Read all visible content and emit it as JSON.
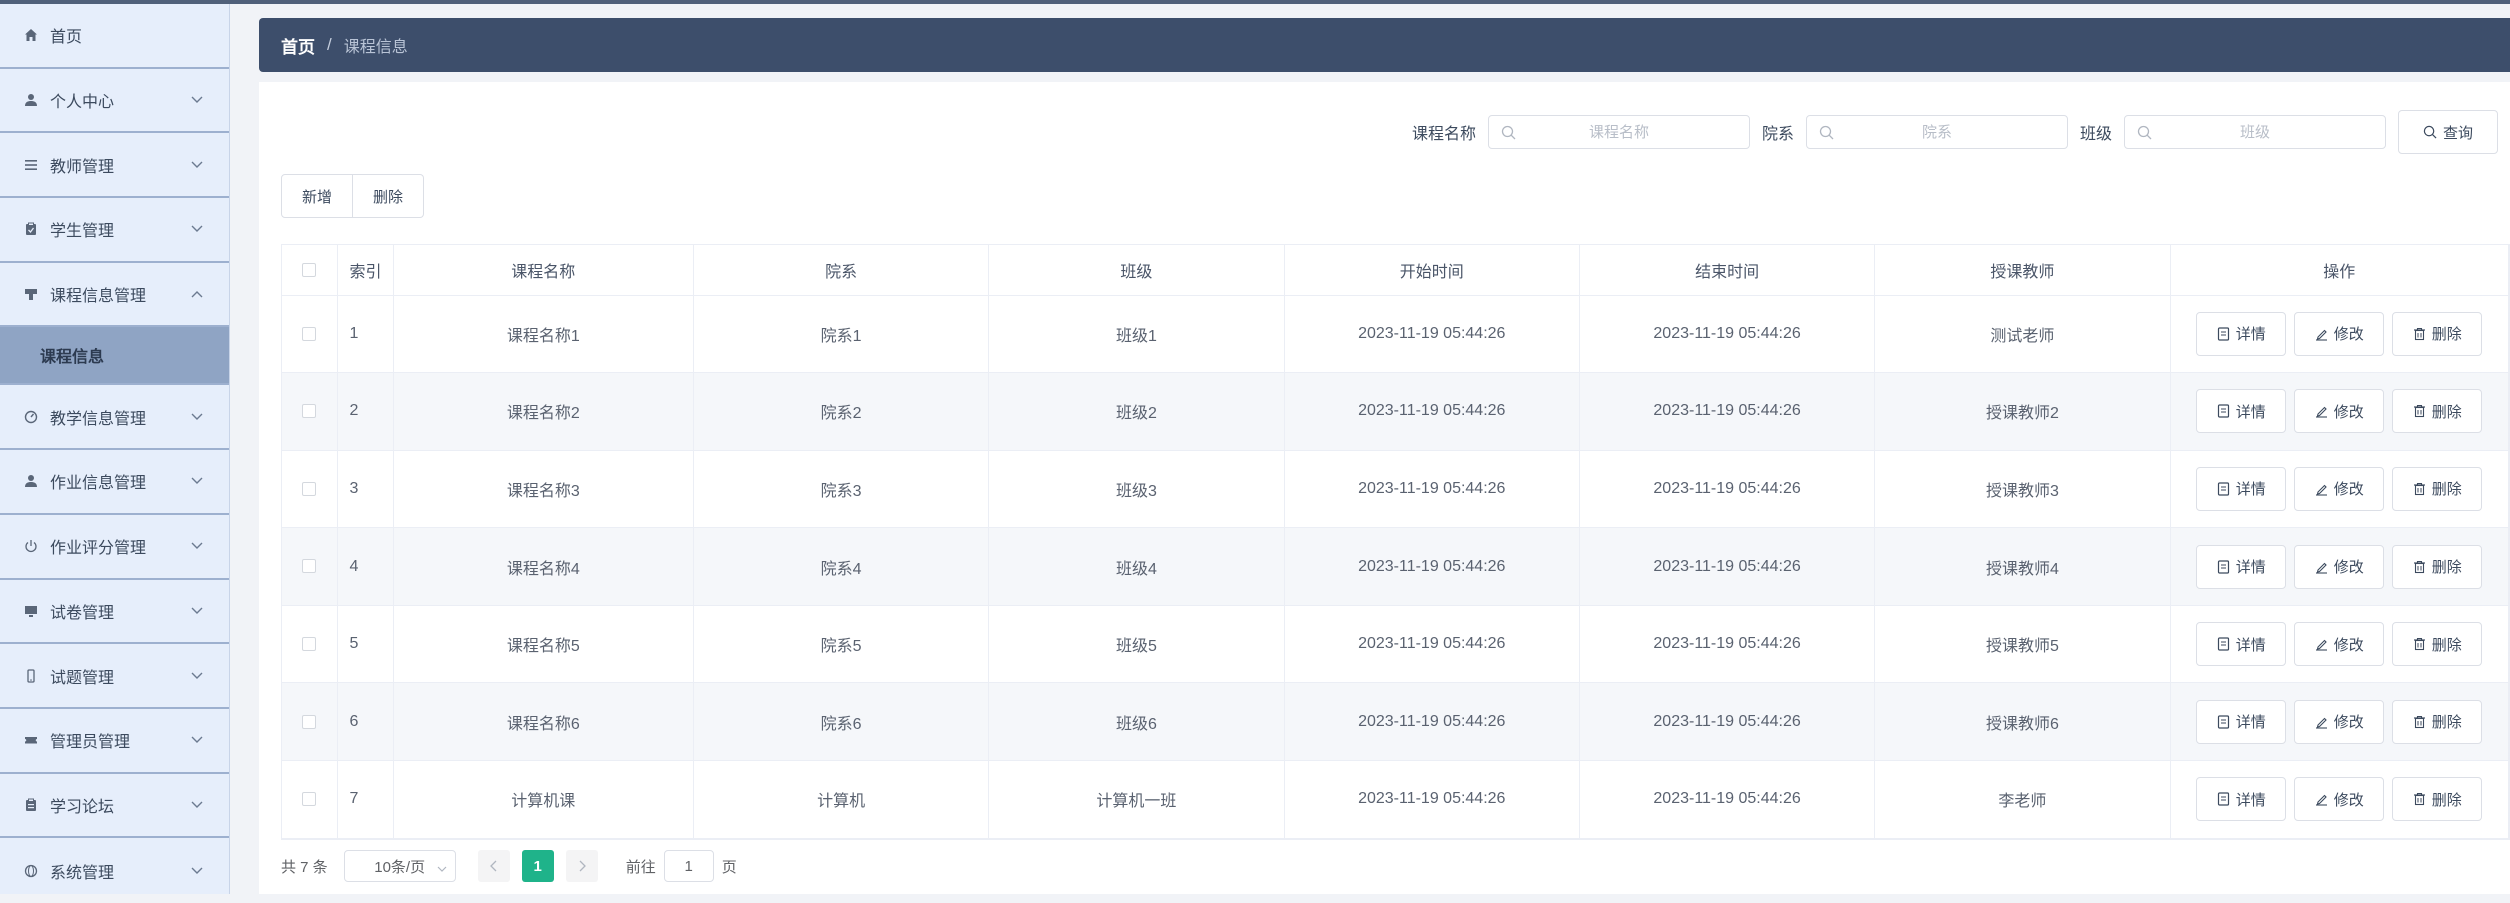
{
  "sidebar": {
    "items": [
      {
        "label": "首页",
        "icon": "home-icon"
      },
      {
        "label": "个人中心",
        "icon": "user-icon"
      },
      {
        "label": "教师管理",
        "icon": "list-icon"
      },
      {
        "label": "学生管理",
        "icon": "clipboard-icon"
      },
      {
        "label": "课程信息管理",
        "icon": "podium-icon"
      },
      {
        "label": "课程信息",
        "icon": ""
      },
      {
        "label": "教学信息管理",
        "icon": "gauge-icon"
      },
      {
        "label": "作业信息管理",
        "icon": "user-icon"
      },
      {
        "label": "作业评分管理",
        "icon": "power-icon"
      },
      {
        "label": "试卷管理",
        "icon": "monitor-icon"
      },
      {
        "label": "试题管理",
        "icon": "phone-icon"
      },
      {
        "label": "管理员管理",
        "icon": "ticket-icon"
      },
      {
        "label": "学习论坛",
        "icon": "clipboard-icon"
      },
      {
        "label": "系统管理",
        "icon": "globe-icon"
      }
    ]
  },
  "breadcrumb": {
    "home": "首页",
    "separator": "/",
    "current": "课程信息"
  },
  "search": {
    "course_label": "课程名称",
    "course_placeholder": "课程名称",
    "dept_label": "院系",
    "dept_placeholder": "院系",
    "class_label": "班级",
    "class_placeholder": "班级",
    "query_label": "查询"
  },
  "actions": {
    "add_label": "新增",
    "delete_label": "删除"
  },
  "table": {
    "headers": [
      "索引",
      "课程名称",
      "院系",
      "班级",
      "开始时间",
      "结束时间",
      "授课教师",
      "操作"
    ],
    "rows": [
      [
        "1",
        "课程名称1",
        "院系1",
        "班级1",
        "2023-11-19 05:44:26",
        "2023-11-19 05:44:26",
        "测试老师"
      ],
      [
        "2",
        "课程名称2",
        "院系2",
        "班级2",
        "2023-11-19 05:44:26",
        "2023-11-19 05:44:26",
        "授课教师2"
      ],
      [
        "3",
        "课程名称3",
        "院系3",
        "班级3",
        "2023-11-19 05:44:26",
        "2023-11-19 05:44:26",
        "授课教师3"
      ],
      [
        "4",
        "课程名称4",
        "院系4",
        "班级4",
        "2023-11-19 05:44:26",
        "2023-11-19 05:44:26",
        "授课教师4"
      ],
      [
        "5",
        "课程名称5",
        "院系5",
        "班级5",
        "2023-11-19 05:44:26",
        "2023-11-19 05:44:26",
        "授课教师5"
      ],
      [
        "6",
        "课程名称6",
        "院系6",
        "班级6",
        "2023-11-19 05:44:26",
        "2023-11-19 05:44:26",
        "授课教师6"
      ],
      [
        "7",
        "计算机课",
        "计算机",
        "计算机一班",
        "2023-11-19 05:44:26",
        "2023-11-19 05:44:26",
        "李老师"
      ]
    ],
    "row_actions": {
      "detail": "详情",
      "edit": "修改",
      "delete": "删除"
    }
  },
  "pagination": {
    "total": "共 7 条",
    "page_size": "10条/页",
    "current_page": "1",
    "goto_prefix": "前往",
    "goto_value": "1",
    "goto_suffix": "页"
  },
  "colors": {
    "header_bar": "#3d4e6b",
    "sidebar_bg": "#e6eefb",
    "active_sub": "#8fa4c4",
    "page_active": "#1fb38a"
  }
}
